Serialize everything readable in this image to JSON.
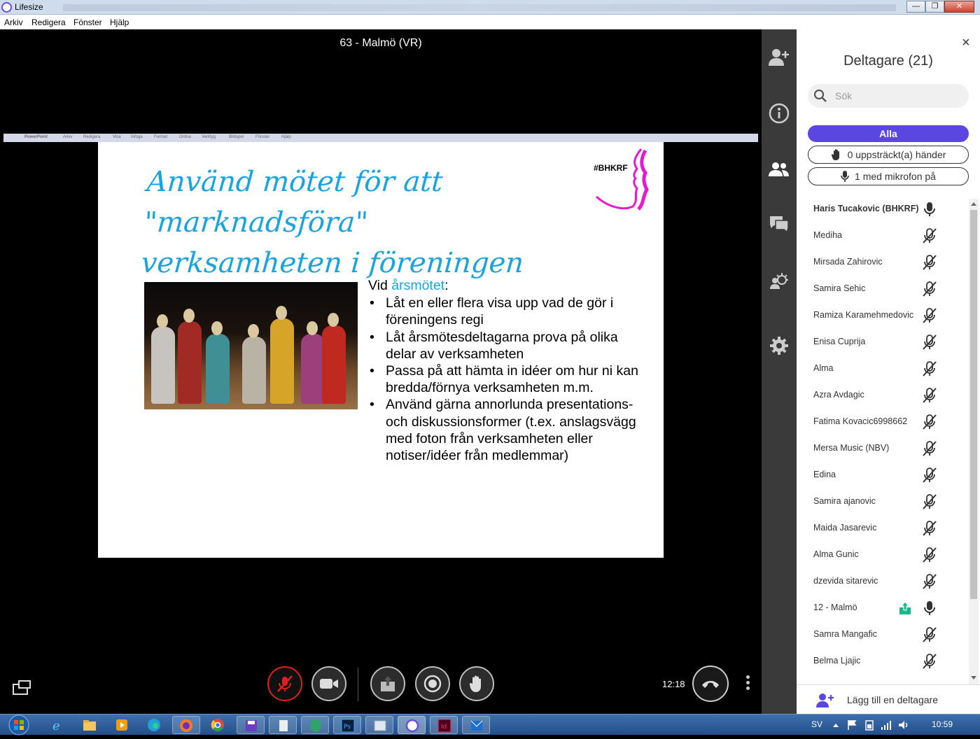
{
  "window": {
    "title": "Lifesize",
    "min": "—",
    "max": "❐",
    "close": "✕"
  },
  "menu": [
    "Arkiv",
    "Redigera",
    "Fönster",
    "Hjälp"
  ],
  "call": {
    "title": "63 - Malmö (VR)",
    "time": "12:18"
  },
  "shared_screen": {
    "mac_menu": [
      "PowerPoint",
      "Arkiv",
      "Redigera",
      "Visa",
      "Infoga",
      "Format",
      "Ordna",
      "Verktyg",
      "Bildspel",
      "Fönster",
      "Hjälp"
    ],
    "slide": {
      "title_line1": "Använd mötet för att \"marknadsföra\"",
      "title_line2": "verksamheten i föreningen",
      "logo_text": "#BHKRF",
      "intro_prefix": "Vid ",
      "intro_highlight": "årsmötet",
      "intro_suffix": ":",
      "bullets": [
        "Låt en eller flera visa upp vad de gör i föreningens regi",
        "Låt årsmötesdeltagarna prova på olika delar av verksamheten",
        "Passa på att hämta in idéer om hur ni kan bredda/förnya verksamheten m.m.",
        "Använd gärna annorlunda presentations- och diskussionsformer (t.ex. anslagsvägg med foton från verksamheten eller notiser/idéer från medlemmar)"
      ]
    }
  },
  "panel": {
    "close": "×",
    "title": "Deltagare (21)",
    "search_placeholder": "Sök",
    "filter_all": "Alla",
    "filter_hands": "0 uppsträckt(a) händer",
    "filter_mic": "1 med mikrofon på",
    "add_participant": "Lägg till en deltagare",
    "participants": [
      {
        "name": "Haris Tucakovic (BHKRF)",
        "bold": true,
        "mic": "on"
      },
      {
        "name": "Mediha",
        "mic": "off"
      },
      {
        "name": "Mirsada Zahirovic",
        "mic": "off"
      },
      {
        "name": "Samira Sehic",
        "mic": "off"
      },
      {
        "name": "Ramiza Karamehmedovic",
        "mic": "off"
      },
      {
        "name": "Enisa Cuprija",
        "mic": "off"
      },
      {
        "name": "Alma",
        "mic": "off"
      },
      {
        "name": "Azra Avdagic",
        "mic": "off"
      },
      {
        "name": "Fatima Kovacic6998662",
        "mic": "off"
      },
      {
        "name": "Mersa Music (NBV)",
        "mic": "off"
      },
      {
        "name": "Edina",
        "mic": "off"
      },
      {
        "name": "Samira ajanovic",
        "mic": "off"
      },
      {
        "name": "Maida Jasarevic",
        "mic": "off"
      },
      {
        "name": "Alma Gunic",
        "mic": "off"
      },
      {
        "name": "dzevida sitarevic",
        "mic": "off"
      },
      {
        "name": "12 - Malmö",
        "mic": "on",
        "sharing": true
      },
      {
        "name": "Samra Mangafic",
        "mic": "off"
      },
      {
        "name": "Belma Ljajic",
        "mic": "off"
      }
    ]
  },
  "taskbar": {
    "language": "SV",
    "clock": "10:59"
  },
  "colors": {
    "accent": "#5a46e0",
    "slide_title": "#1aa3dc",
    "mic_muted_ring": "#e02020",
    "share_icon": "#1db58a"
  }
}
